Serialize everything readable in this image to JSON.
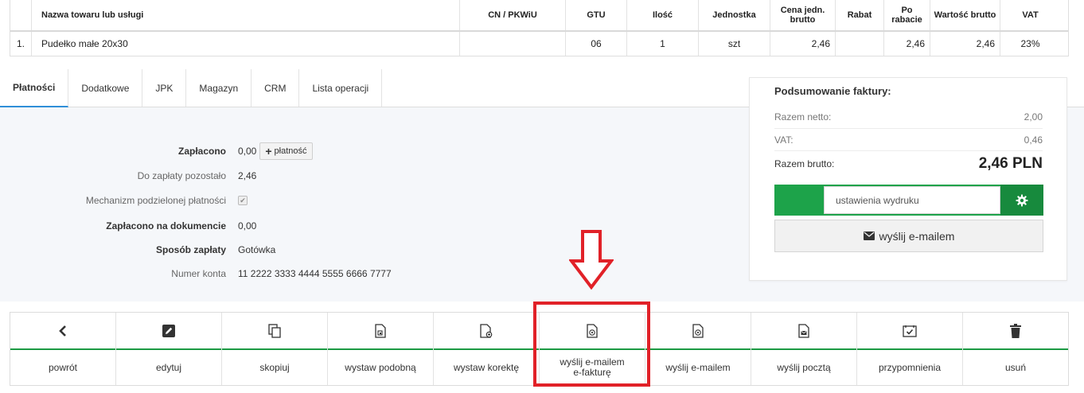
{
  "items_table": {
    "headers": [
      "",
      "Nazwa towaru lub usługi",
      "CN / PKWiU",
      "GTU",
      "Ilość",
      "Jednostka",
      "Cena jedn. brutto",
      "Rabat",
      "Po rabacie",
      "Wartość brutto",
      "VAT"
    ],
    "rows": [
      [
        "1.",
        "Pudełko małe 20x30",
        "",
        "06",
        "1",
        "szt",
        "2,46",
        "",
        "2,46",
        "2,46",
        "23%"
      ]
    ]
  },
  "tabs": [
    {
      "label": "Płatności",
      "active": true
    },
    {
      "label": "Dodatkowe",
      "active": false
    },
    {
      "label": "JPK",
      "active": false
    },
    {
      "label": "Magazyn",
      "active": false
    },
    {
      "label": "CRM",
      "active": false
    },
    {
      "label": "Lista operacji",
      "active": false
    }
  ],
  "payments": {
    "paid_label": "Zapłacono",
    "paid_value": "0,00",
    "add_payment_label": "płatność",
    "remaining_label": "Do zapłaty pozostało",
    "remaining_value": "2,46",
    "split_label": "Mechanizm podzielonej płatności",
    "split_checked": true,
    "paid_doc_label": "Zapłacono na dokumencie",
    "paid_doc_value": "0,00",
    "method_label": "Sposób zapłaty",
    "method_value": "Gotówka",
    "account_label": "Numer konta",
    "account_value": "11 2222 3333 4444 5555 6666 7777"
  },
  "summary": {
    "title": "Podsumowanie faktury:",
    "net_label": "Razem netto:",
    "net_value": "2,00",
    "vat_label": "VAT:",
    "vat_value": "0,46",
    "gross_label": "Razem brutto:",
    "gross_value": "2,46 PLN",
    "print_settings_label": "ustawienia wydruku",
    "email_button_label": "wyślij e-mailem"
  },
  "actions": [
    {
      "label": "powrót",
      "icon": "chevron-left-icon"
    },
    {
      "label": "edytuj",
      "icon": "edit-icon"
    },
    {
      "label": "skopiuj",
      "icon": "copy-icon"
    },
    {
      "label": "wystaw podobną",
      "icon": "document-similar-icon"
    },
    {
      "label": "wystaw korektę",
      "icon": "document-correction-icon"
    },
    {
      "label": "wyślij e-mailem e-fakturę",
      "icon": "document-at-icon"
    },
    {
      "label": "wyślij e-mailem",
      "icon": "document-at-icon"
    },
    {
      "label": "wyślij pocztą",
      "icon": "document-mail-icon"
    },
    {
      "label": "przypomnienia",
      "icon": "calendar-check-icon"
    },
    {
      "label": "usuń",
      "icon": "trash-icon"
    }
  ],
  "colors": {
    "accent_green": "#1da34a",
    "accent_green_dark": "#178a3d",
    "tab_active_underline": "#2f8fd8",
    "annotation_red": "#e12128"
  }
}
